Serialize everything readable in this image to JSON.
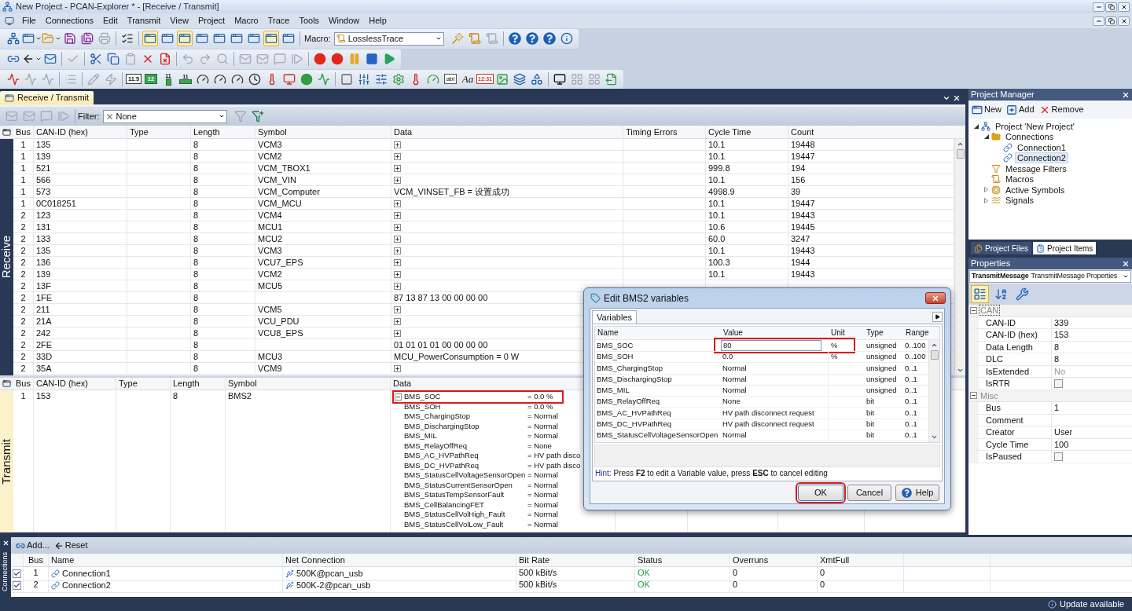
{
  "window": {
    "title": "New Project - PCAN-Explorer * - [Receive / Transmit]"
  },
  "menu": [
    "File",
    "Connections",
    "Edit",
    "Transmit",
    "View",
    "Project",
    "Macro",
    "Trace",
    "Tools",
    "Window",
    "Help"
  ],
  "toolbar_1": {
    "items_left": [
      {
        "kind": "project",
        "disabled": false
      },
      {
        "kind": "window",
        "disabled": false,
        "dropdown": true
      },
      {
        "kind": "open",
        "disabled": false,
        "dropdown": true
      },
      {
        "kind": "save",
        "disabled": false
      },
      {
        "kind": "save-all",
        "disabled": false
      },
      {
        "kind": "print",
        "disabled": true
      },
      {
        "kind": "separator"
      },
      {
        "kind": "checklist",
        "disabled": false
      },
      {
        "kind": "separator"
      },
      {
        "kind": "window",
        "disabled": false,
        "selected": true
      },
      {
        "kind": "window",
        "disabled": false,
        "selected": false
      },
      {
        "kind": "window",
        "disabled": false,
        "selected": true
      },
      {
        "kind": "window",
        "disabled": false,
        "selected": false
      },
      {
        "kind": "window",
        "disabled": false,
        "selected": false
      },
      {
        "kind": "window",
        "disabled": false,
        "selected": false
      },
      {
        "kind": "window",
        "disabled": false,
        "selected": false
      },
      {
        "kind": "window",
        "disabled": false,
        "selected": true
      },
      {
        "kind": "window",
        "disabled": false,
        "selected": false
      },
      {
        "kind": "separator"
      }
    ],
    "macro": {
      "label": "Macro:",
      "value": "LosslessTrace"
    },
    "items_right": [
      {
        "kind": "macro-edit",
        "disabled": false
      },
      {
        "kind": "macro-run",
        "disabled": false
      },
      {
        "kind": "macro-stop",
        "disabled": true
      },
      {
        "kind": "separator"
      },
      {
        "kind": "help",
        "disabled": false
      },
      {
        "kind": "help",
        "disabled": false
      },
      {
        "kind": "help",
        "disabled": false
      },
      {
        "kind": "about",
        "disabled": false
      }
    ]
  },
  "toolbar_2": {
    "items": [
      {
        "kind": "link",
        "disabled": false
      },
      {
        "kind": "back",
        "disabled": false,
        "dropdown": true
      },
      {
        "kind": "mail-clock",
        "disabled": false
      },
      {
        "kind": "separator"
      },
      {
        "kind": "check",
        "disabled": true
      },
      {
        "kind": "separator"
      },
      {
        "kind": "cut",
        "disabled": false
      },
      {
        "kind": "copy",
        "disabled": false
      },
      {
        "kind": "paste",
        "disabled": true
      },
      {
        "kind": "delete",
        "disabled": false
      },
      {
        "kind": "delete-file",
        "disabled": false
      },
      {
        "kind": "separator"
      },
      {
        "kind": "undo",
        "disabled": true
      },
      {
        "kind": "redo",
        "disabled": true
      },
      {
        "kind": "find",
        "disabled": true
      },
      {
        "kind": "separator"
      },
      {
        "kind": "mail",
        "disabled": true
      },
      {
        "kind": "mail-edit",
        "disabled": true
      },
      {
        "kind": "message",
        "disabled": true
      },
      {
        "kind": "step",
        "disabled": true
      },
      {
        "kind": "separator"
      },
      {
        "kind": "record",
        "disabled": false
      },
      {
        "kind": "record",
        "disabled": false
      },
      {
        "kind": "pause",
        "disabled": false
      },
      {
        "kind": "stop",
        "disabled": false
      },
      {
        "kind": "play",
        "disabled": false
      }
    ]
  },
  "toolbar_3": {
    "items": [
      {
        "kind": "trace",
        "disabled": false
      },
      {
        "kind": "trace",
        "disabled": true
      },
      {
        "kind": "trace",
        "disabled": true
      },
      {
        "kind": "separator"
      },
      {
        "kind": "list",
        "disabled": true
      },
      {
        "kind": "separator"
      },
      {
        "kind": "edit",
        "disabled": true
      },
      {
        "kind": "lightning",
        "disabled": true
      },
      {
        "kind": "separator"
      },
      {
        "kind": "numeric",
        "disabled": false,
        "text": "11.5"
      },
      {
        "kind": "numeric-green",
        "disabled": false,
        "text": "12"
      },
      {
        "kind": "bar-vertical",
        "disabled": false,
        "text": "11"
      },
      {
        "kind": "bar-horizontal",
        "disabled": false,
        "text": "11"
      },
      {
        "kind": "gauge",
        "disabled": false
      },
      {
        "kind": "gauge",
        "disabled": false
      },
      {
        "kind": "gauge",
        "disabled": false
      },
      {
        "kind": "dial",
        "disabled": false
      },
      {
        "kind": "level-red",
        "disabled": false
      },
      {
        "kind": "display",
        "disabled": false
      },
      {
        "kind": "led",
        "disabled": false
      },
      {
        "kind": "mini-chart",
        "disabled": false
      },
      {
        "kind": "separator"
      },
      {
        "kind": "rectangle",
        "disabled": false
      },
      {
        "kind": "slider-vertical",
        "disabled": false
      },
      {
        "kind": "slider-horizontal",
        "disabled": false
      },
      {
        "kind": "rotary",
        "disabled": false
      },
      {
        "kind": "level-red",
        "disabled": false
      },
      {
        "kind": "gauge-box",
        "disabled": false
      },
      {
        "kind": "text-box",
        "disabled": false,
        "text": "abl"
      },
      {
        "kind": "font",
        "disabled": false,
        "text": "Aa"
      },
      {
        "kind": "clock-display",
        "disabled": false,
        "text": "12:31"
      },
      {
        "kind": "picture",
        "disabled": false
      },
      {
        "kind": "layers",
        "disabled": false
      },
      {
        "kind": "shapes",
        "disabled": false
      },
      {
        "kind": "separator"
      },
      {
        "kind": "scope",
        "disabled": false
      },
      {
        "kind": "grid",
        "disabled": true
      },
      {
        "kind": "grid",
        "disabled": true
      },
      {
        "kind": "export",
        "disabled": false
      }
    ]
  },
  "document": {
    "tab": "Receive / Transmit",
    "toolbar": {
      "items": [
        {
          "kind": "mail",
          "disabled": true
        },
        {
          "kind": "mail-edit",
          "disabled": true
        },
        {
          "kind": "message",
          "disabled": true
        },
        {
          "kind": "step",
          "disabled": true
        },
        {
          "kind": "separator"
        }
      ],
      "filter": {
        "label": "Filter:",
        "value": "None"
      },
      "filter_buttons": [
        {
          "kind": "funnel",
          "disabled": true
        },
        {
          "kind": "funnel-add",
          "disabled": false
        }
      ]
    },
    "receive": {
      "side_label": "Receive",
      "columns": [
        "Bus",
        "CAN-ID (hex)",
        "Type",
        "Length",
        "Symbol",
        "Data",
        "Timing Errors",
        "Cycle Time",
        "Count"
      ],
      "rows": [
        {
          "bus": "1",
          "can_id": "135",
          "length": "8",
          "symbol": "VCM3",
          "expanded": false,
          "cycle_time": "10.1",
          "count": "19448"
        },
        {
          "bus": "1",
          "can_id": "139",
          "length": "8",
          "symbol": "VCM2",
          "expanded": false,
          "cycle_time": "10.1",
          "count": "19447"
        },
        {
          "bus": "1",
          "can_id": "521",
          "length": "8",
          "symbol": "VCM_TBOX1",
          "expanded": false,
          "cycle_time": "999.8",
          "count": "194"
        },
        {
          "bus": "1",
          "can_id": "566",
          "length": "8",
          "symbol": "VCM_VIN",
          "expanded": false,
          "cycle_time": "10.1",
          "count": "156"
        },
        {
          "bus": "1",
          "can_id": "573",
          "length": "8",
          "symbol": "VCM_Computer",
          "data": "VCM_VINSET_FB = 设置成功",
          "cycle_time": "4998.9",
          "count": "39"
        },
        {
          "bus": "1",
          "can_id": "0C018251",
          "length": "8",
          "symbol": "VCM_MCU",
          "expanded": false,
          "cycle_time": "10.1",
          "count": "19447"
        },
        {
          "bus": "2",
          "can_id": "123",
          "length": "8",
          "symbol": "VCM4",
          "expanded": false,
          "cycle_time": "10.1",
          "count": "19443"
        },
        {
          "bus": "2",
          "can_id": "131",
          "length": "8",
          "symbol": "MCU1",
          "expanded": false,
          "cycle_time": "10.6",
          "count": "19445"
        },
        {
          "bus": "2",
          "can_id": "133",
          "length": "8",
          "symbol": "MCU2",
          "expanded": false,
          "cycle_time": "60.0",
          "count": "3247"
        },
        {
          "bus": "2",
          "can_id": "135",
          "length": "8",
          "symbol": "VCM3",
          "expanded": false,
          "cycle_time": "10.1",
          "count": "19443"
        },
        {
          "bus": "2",
          "can_id": "136",
          "length": "8",
          "symbol": "VCU7_EPS",
          "expanded": false,
          "cycle_time": "100.3",
          "count": "1944"
        },
        {
          "bus": "2",
          "can_id": "139",
          "length": "8",
          "symbol": "VCM2",
          "expanded": false,
          "cycle_time": "10.1",
          "count": "19443"
        },
        {
          "bus": "2",
          "can_id": "13F",
          "length": "8",
          "symbol": "MCU5",
          "expanded": false
        },
        {
          "bus": "2",
          "can_id": "1FE",
          "length": "8",
          "data": "87 13 87 13 00 00 00 00"
        },
        {
          "bus": "2",
          "can_id": "211",
          "length": "8",
          "symbol": "VCM5",
          "expanded": false
        },
        {
          "bus": "2",
          "can_id": "21A",
          "length": "8",
          "symbol": "VCU_PDU",
          "expanded": false
        },
        {
          "bus": "2",
          "can_id": "242",
          "length": "8",
          "symbol": "VCU8_EPS",
          "expanded": false
        },
        {
          "bus": "2",
          "can_id": "2FE",
          "length": "8",
          "data": "01 01 01 01 00 00 00 00"
        },
        {
          "bus": "2",
          "can_id": "33D",
          "length": "8",
          "symbol": "MCU3",
          "data": "MCU_PowerConsumption = 0 W"
        },
        {
          "bus": "2",
          "can_id": "35A",
          "length": "8",
          "symbol": "VCM9",
          "expanded": false
        }
      ]
    },
    "transmit": {
      "side_label": "Transmit",
      "columns": [
        "Bus",
        "CAN-ID (hex)",
        "Type",
        "Length",
        "Symbol",
        "Data"
      ],
      "rows": [
        {
          "bus": "1",
          "can_id": "153",
          "length": "8",
          "symbol": "BMS2",
          "expanded": true,
          "signals": [
            {
              "name": "BMS_SOC",
              "value": "= 0.0 %",
              "annotated": true
            },
            {
              "name": "BMS_SOH",
              "value": "= 0.0 %",
              "annotated": false
            },
            {
              "name": "BMS_ChargingStop",
              "value": "= Normal",
              "annotated": false
            },
            {
              "name": "BMS_DischargingStop",
              "value": "= Normal",
              "annotated": false
            },
            {
              "name": "BMS_MIL",
              "value": "= Normal",
              "annotated": false
            },
            {
              "name": "BMS_RelayOffReq",
              "value": "= None",
              "annotated": false
            },
            {
              "name": "BMS_AC_HVPathReq",
              "value": "= HV path disco",
              "annotated": false
            },
            {
              "name": "BMS_DC_HVPathReq",
              "value": "= HV path disco",
              "annotated": false
            },
            {
              "name": "BMS_StatusCellVoltageSensorOpen",
              "value": "= Normal",
              "annotated": false
            },
            {
              "name": "BMS_StatusCurrentSensorOpen",
              "value": "= Normal",
              "annotated": false
            },
            {
              "name": "BMS_StatusTempSensorFault",
              "value": "= Normal",
              "annotated": false
            },
            {
              "name": "BMS_CellBalancingFET",
              "value": "= Normal",
              "annotated": false
            },
            {
              "name": "BMS_StatusCellVolHigh_Fault",
              "value": "= Normal",
              "annotated": false
            },
            {
              "name": "BMS_StatusCellVolLow_Fault",
              "value": "= Normal",
              "annotated": false
            }
          ]
        }
      ]
    }
  },
  "dialog": {
    "title": "Edit BMS2 variables",
    "tab": "Variables",
    "columns": [
      "Name",
      "Value",
      "Unit",
      "Type",
      "Range"
    ],
    "rows": [
      {
        "name": "BMS_SOC",
        "value": "80",
        "unit": "%",
        "type": "unsigned",
        "range": "0..100",
        "editing": true,
        "annotated": true
      },
      {
        "name": "BMS_SOH",
        "value": "0.0",
        "unit": "%",
        "type": "unsigned",
        "range": "0..100",
        "editing": false,
        "annotated": false
      },
      {
        "name": "BMS_ChargingStop",
        "value": "Normal",
        "type": "unsigned",
        "range": "0..1",
        "editing": false,
        "annotated": false
      },
      {
        "name": "BMS_DischargingStop",
        "value": "Normal",
        "type": "unsigned",
        "range": "0..1",
        "editing": false,
        "annotated": false
      },
      {
        "name": "BMS_MIL",
        "value": "Normal",
        "type": "unsigned",
        "range": "0..1",
        "editing": false,
        "annotated": false
      },
      {
        "name": "BMS_RelayOffReq",
        "value": "None",
        "type": "bit",
        "range": "0..1",
        "editing": false,
        "annotated": false
      },
      {
        "name": "BMS_AC_HVPathReq",
        "value": "HV path disconnect request",
        "type": "bit",
        "range": "0..1",
        "editing": false,
        "annotated": false
      },
      {
        "name": "BMS_DC_HVPathReq",
        "value": "HV path disconnect request",
        "type": "bit",
        "range": "0..1",
        "editing": false,
        "annotated": false
      },
      {
        "name": "BMS_StatusCellVoltageSensorOpen",
        "value": "Normal",
        "type": "bit",
        "range": "0..1",
        "editing": false,
        "annotated": false
      }
    ],
    "hint_label": "Hint:",
    "hint": "Press **F2** to edit a Variable value, press **ESC** to cancel editing",
    "buttons": [
      {
        "label": "OK",
        "kind": "default",
        "annotated": true
      },
      {
        "label": "Cancel",
        "kind": "plain",
        "annotated": false
      },
      {
        "label": "Help",
        "kind": "help",
        "annotated": false
      }
    ]
  },
  "project_manager": {
    "title": "Project Manager",
    "toolbar": [
      {
        "label": "New",
        "kind": "new"
      },
      {
        "label": "Add",
        "kind": "add"
      },
      {
        "label": "Remove",
        "kind": "remove"
      }
    ],
    "tree": [
      {
        "label": "Project 'New Project'",
        "kind": "project",
        "expanded": true,
        "selected": false,
        "children": [
          {
            "label": "Connections",
            "kind": "folder",
            "expanded": true,
            "selected": false,
            "children": [
              {
                "label": "Connection1",
                "kind": "connection",
                "selected": false
              },
              {
                "label": "Connection2",
                "kind": "connection",
                "selected": true
              }
            ]
          },
          {
            "label": "Message Filters",
            "kind": "filter",
            "selected": false
          },
          {
            "label": "Macros",
            "kind": "macro",
            "selected": false
          },
          {
            "label": "Active Symbols",
            "kind": "symbols",
            "expanded": false,
            "selected": false
          },
          {
            "label": "Signals",
            "kind": "signals",
            "expanded": false,
            "selected": false
          }
        ]
      }
    ],
    "tabs": [
      {
        "label": "Project Files",
        "kind": "files",
        "selected": false
      },
      {
        "label": "Project Items",
        "kind": "items",
        "selected": true
      }
    ]
  },
  "properties": {
    "title": "Properties",
    "object_name": "TransmitMessage",
    "object_type": "TransmitMessage Properties",
    "view_buttons": [
      {
        "kind": "categorized",
        "selected": true
      },
      {
        "kind": "alphabetical",
        "selected": false
      },
      {
        "kind": "pages",
        "selected": false
      }
    ],
    "categories": [
      {
        "label": "CAN",
        "expanded": true,
        "selected": true,
        "rows": [
          {
            "name": "CAN-ID",
            "kind": "text",
            "value": "339",
            "disabled": false
          },
          {
            "name": "CAN-ID (hex)",
            "kind": "text",
            "value": "153",
            "disabled": false
          },
          {
            "name": "Data Length",
            "kind": "text",
            "value": "8",
            "disabled": false
          },
          {
            "name": "DLC",
            "kind": "text",
            "value": "8",
            "disabled": false
          },
          {
            "name": "IsExtended",
            "kind": "text",
            "value": "No",
            "disabled": true
          },
          {
            "name": "IsRTR",
            "kind": "checkbox",
            "checked": false,
            "disabled": false
          }
        ]
      },
      {
        "label": "Misc",
        "expanded": true,
        "selected": false,
        "rows": [
          {
            "name": "Bus",
            "kind": "text",
            "value": "1",
            "disabled": false
          },
          {
            "name": "Comment",
            "kind": "text"
          },
          {
            "name": "Creator",
            "kind": "text",
            "value": "User",
            "disabled": false
          },
          {
            "name": "Cycle Time",
            "kind": "text",
            "value": "100",
            "disabled": false
          },
          {
            "name": "IsPaused",
            "kind": "checkbox",
            "checked": false,
            "disabled": false
          }
        ]
      }
    ]
  },
  "connections": {
    "side_label": "Connections",
    "toolbar": [
      {
        "label": "Add...",
        "kind": "add"
      },
      {
        "label": "Reset",
        "kind": "reset"
      }
    ],
    "columns": [
      "Bus",
      "Name",
      "Net Connection",
      "Bit Rate",
      "Status",
      "Overruns",
      "XmtFull"
    ],
    "rows": [
      {
        "checked": true,
        "bus": "1",
        "name": "Connection1",
        "net_connection": "500K@pcan_usb",
        "bit_rate": "500 kBit/s",
        "status": "OK",
        "overruns": "0",
        "xmt_full": "0"
      },
      {
        "checked": true,
        "bus": "2",
        "name": "Connection2",
        "net_connection": "500K-2@pcan_usb",
        "bit_rate": "500 kBit/s",
        "status": "OK",
        "overruns": "0",
        "xmt_full": "0"
      }
    ]
  },
  "status_bar": {
    "message": "Update available"
  }
}
